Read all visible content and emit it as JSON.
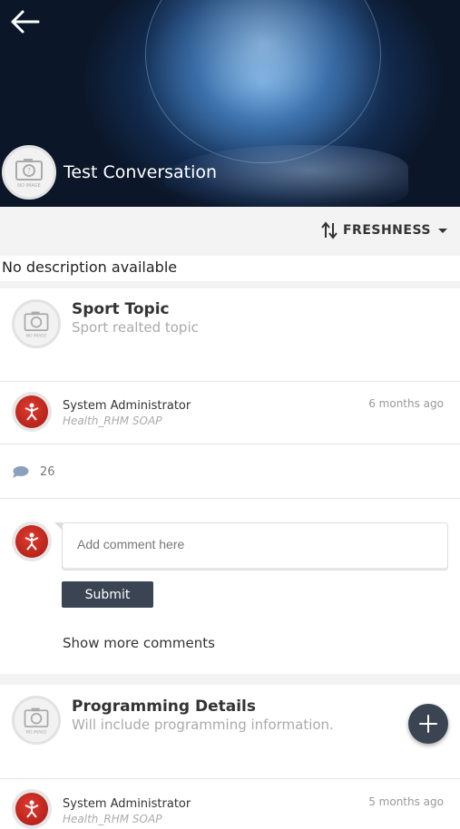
{
  "header": {
    "back_icon": "arrow-left-icon",
    "title": "Test Conversation",
    "avatar_placeholder_text": "NO IMAGE"
  },
  "sort": {
    "label": "FRESHNESS",
    "icon": "sort-arrows-icon",
    "dropdown_icon": "caret-down-icon"
  },
  "description": "No description available",
  "topics": [
    {
      "title": "Sport Topic",
      "subtitle": "Sport realted topic",
      "author_name": "System Administrator",
      "author_group": "Health_RHM SOAP",
      "timestamp": "6 months ago",
      "comment_count": "26",
      "comment_placeholder": "Add comment here",
      "submit_label": "Submit",
      "show_more_label": "Show more comments"
    },
    {
      "title": "Programming Details",
      "subtitle": "Will include programming information.",
      "author_name": "System Administrator",
      "author_group": "Health_RHM SOAP",
      "timestamp": "5 months ago"
    }
  ],
  "fab": {
    "icon": "plus-icon"
  },
  "colors": {
    "button_dark": "#3b4453",
    "badge_red": "#c8231b",
    "muted_text": "#aaaaaa"
  }
}
